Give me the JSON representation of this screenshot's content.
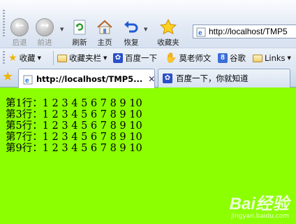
{
  "toolbar": {
    "back_label": "后退",
    "forward_label": "前进",
    "refresh_label": "刷新",
    "home_label": "主页",
    "restore_label": "恢复",
    "favorites_label": "收藏夹"
  },
  "address_bar": {
    "url": "http://localhost/TMP5"
  },
  "favorites_bar": {
    "favorites_menu": "收藏",
    "items": [
      {
        "label": "收藏夹栏",
        "icon": "folder-icon"
      },
      {
        "label": "百度一下",
        "icon": "baidu-paw-icon"
      },
      {
        "label": "莫老师文",
        "icon": "hand-icon"
      },
      {
        "label": "谷歌",
        "icon": "google-icon"
      },
      {
        "label": "Links",
        "icon": "folder-icon"
      }
    ]
  },
  "tabs": [
    {
      "title": "http://localhost/TMP5...",
      "active": true
    },
    {
      "title": "百度一下，你就知道",
      "active": false
    }
  ],
  "content": {
    "rows": [
      "第1行：1 2 3 4 5 6 7 8 9 10",
      "第3行：1 2 3 4 5 6 7 8 9 10",
      "第5行：1 2 3 4 5 6 7 8 9 10",
      "第7行：1 2 3 4 5 6 7 8 9 10",
      "第9行：1 2 3 4 5 6 7 8 9 10"
    ],
    "background_color": "#8cff00"
  },
  "watermark": {
    "brand": "Bai经验",
    "url": "jingyan.baidu.com"
  }
}
